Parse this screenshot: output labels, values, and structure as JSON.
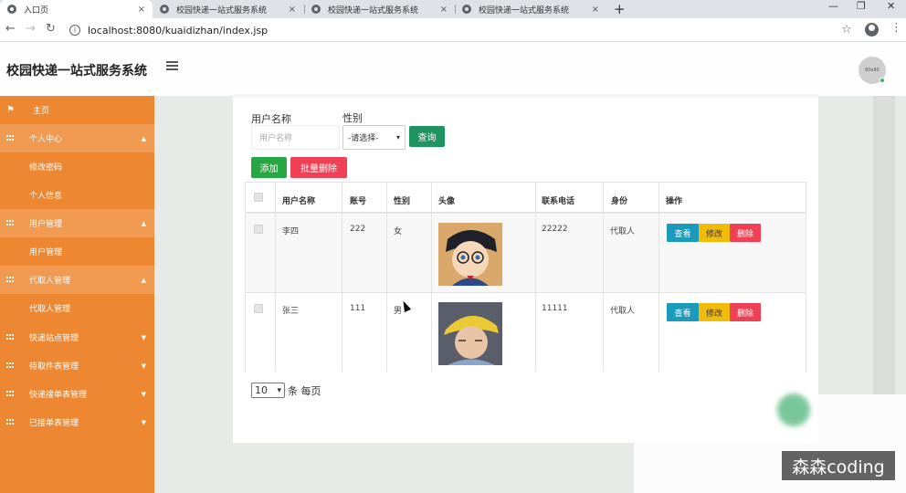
{
  "browser": {
    "tabs": [
      {
        "label": "入口页",
        "active": true
      },
      {
        "label": "校园快递一站式服务系统",
        "active": false
      },
      {
        "label": "校园快递一站式服务系统",
        "active": false
      },
      {
        "label": "校园快递一站式服务系统",
        "active": false
      }
    ],
    "url": "localhost:8080/kuaidizhan/index.jsp",
    "new_tab": "+",
    "close_glyph": "×"
  },
  "header": {
    "brand": "校园快递一站式服务系统",
    "avatar_text": "80x80"
  },
  "sidebar": {
    "items": [
      {
        "label": "主页",
        "type": "home"
      },
      {
        "label": "个人中心",
        "type": "group",
        "caret": "▲"
      },
      {
        "label": "修改密码",
        "type": "sub"
      },
      {
        "label": "个人信息",
        "type": "sub"
      },
      {
        "label": "用户管理",
        "type": "group",
        "caret": "▲"
      },
      {
        "label": "用户管理",
        "type": "sub"
      },
      {
        "label": "代取人管理",
        "type": "group",
        "caret": "▲"
      },
      {
        "label": "代取人管理",
        "type": "sub"
      },
      {
        "label": "快递站点管理",
        "type": "collapsed",
        "caret": "▼"
      },
      {
        "label": "待取件表管理",
        "type": "collapsed",
        "caret": "▼"
      },
      {
        "label": "快递接单表管理",
        "type": "collapsed",
        "caret": "▼"
      },
      {
        "label": "已接单表管理",
        "type": "collapsed",
        "caret": "▼"
      }
    ]
  },
  "search": {
    "username_label": "用户名称",
    "username_placeholder": "用户名称",
    "gender_label": "性别",
    "gender_selected": "-请选择-",
    "query_button": "查询"
  },
  "actions": {
    "add": "添加",
    "batch_delete": "批量删除"
  },
  "table": {
    "headers": [
      "用户名称",
      "账号",
      "性别",
      "头像",
      "联系电话",
      "身份",
      "操作"
    ],
    "rows": [
      {
        "name": "李四",
        "account": "222",
        "gender": "女",
        "phone": "22222",
        "role": "代取人"
      },
      {
        "name": "张三",
        "account": "111",
        "gender": "男",
        "phone": "11111",
        "role": "代取人"
      }
    ],
    "row_actions": {
      "view": "查看",
      "edit": "修改",
      "delete": "删除"
    }
  },
  "pagination": {
    "page_size": "10",
    "suffix": "条 每页"
  },
  "watermark": "森森coding"
}
